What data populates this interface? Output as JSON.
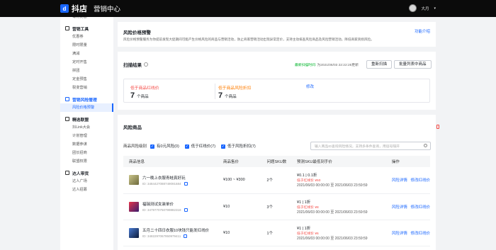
{
  "topbar": {
    "logo_mark": "d",
    "brand": "抖店",
    "subtitle": "营销中心",
    "user_name": "大月",
    "caret": "▾"
  },
  "sidebar": {
    "top_partial": "每购优惠",
    "groups": [
      {
        "label": "营销工具",
        "items": [
          "优惠券",
          "限时限量",
          "满减",
          "定时开售",
          "拼团",
          "定金预售",
          "裂变营销"
        ]
      },
      {
        "label": "营销风险管理",
        "items": [
          "风险价格预警"
        ]
      },
      {
        "label": "精选联盟",
        "items": [
          "抖Link大会",
          "计划管理",
          "数据参谋",
          "团长招商",
          "联盟权限"
        ]
      },
      {
        "label": "达人带货",
        "items": [
          "达人广场",
          "达人招募"
        ]
      }
    ]
  },
  "info_card": {
    "title": "风险价格预警",
    "link": "功能介绍",
    "desc": "风险价格预警服务为你提前发现大促期间可能产生价格风险的商品与营销活动，防止商家营销活动出现异常定价，支持主动排查风险商品及风险营销活动，降低商家资损风险。"
  },
  "scan_card": {
    "title": "扫描结果",
    "help_icon": "help-circle-icon",
    "status_green": "最新扫描时间:",
    "status_time": "为2021/06/03 22:22:25更新",
    "btn_scan": "重新扫描",
    "btn_batch": "批量列表中商品",
    "metric1_label": "低于商品红线价",
    "metric1_value": "7",
    "metric1_unit": "个商品",
    "metric2_label": "低于商品风险折扣",
    "metric2_value": "7",
    "metric2_unit": "个商品",
    "edit": "修改"
  },
  "risk_card": {
    "title": "风险商品",
    "filter_label": "商品风险级别",
    "filters": [
      {
        "label": "有0元风险(0)"
      },
      {
        "label": "低于红线价(7)"
      },
      {
        "label": "低于风险折扣(7)"
      }
    ],
    "search_placeholder": "输入商品ID查询风险情况，支持多条件查询，用逗号隔开",
    "columns": [
      "商品信息",
      "商品售价",
      "问题SKU数",
      "预测SKU最低到手价",
      "操作"
    ],
    "rows": [
      {
        "name": "六一晚上衣服青蛙真好玩",
        "id": "ID: 3484427088749091684",
        "price": "¥100 ~ ¥300",
        "sku": "2个",
        "predict": "¥0.1 | 0.1折",
        "tag": "低于红线价 ¥50",
        "period": "2021/06/03 00:00:00 至 2021/06/03 23:59:59",
        "action1": "风险详情",
        "action2": "修改红线价"
      },
      {
        "name": "福瑞测试女装单价",
        "id": "ID: 3479770750799882318",
        "price": "¥10",
        "sku": "3个",
        "predict": "¥1 | 1折",
        "tag": "低于红线价 ¥8",
        "period": "2021/06/03 00:00:00 至 2021/06/03 23:59:59",
        "action1": "风险详情",
        "action2": "修改红线价"
      },
      {
        "name": "五月二十四日衣服10块钱只能发红线价",
        "id": "ID: 3482297067950979411",
        "price": "¥10",
        "sku": "1个",
        "predict": "¥1 | 1折",
        "tag": "低于红线价 ¥6",
        "period": "2021/06/03 00:00:00 至 2021/06/03 23:59:59",
        "action1": "风险详情",
        "action2": "修改红线价"
      }
    ]
  },
  "colors": {
    "brand": "#1966ff",
    "danger": "#f54a45",
    "success": "#00b42a",
    "warning": "#ff7d00"
  }
}
